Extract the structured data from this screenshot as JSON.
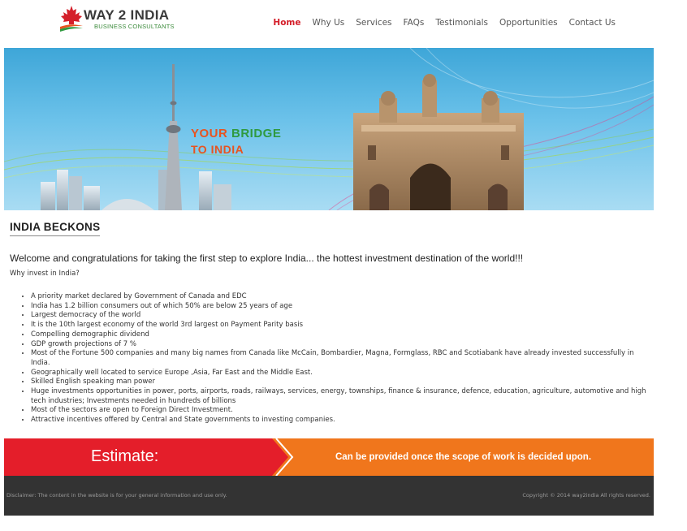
{
  "brand": {
    "name": "WAY 2 INDIA",
    "subtitle": "BUSINESS CONSULTANTS",
    "leaf_color": "#d41f2a"
  },
  "nav": {
    "items": [
      {
        "label": "Home",
        "active": true
      },
      {
        "label": "Why Us"
      },
      {
        "label": "Services"
      },
      {
        "label": "FAQs"
      },
      {
        "label": "Testimonials"
      },
      {
        "label": "Opportunities"
      },
      {
        "label": "Contact Us"
      }
    ],
    "active_color": "#d41f2a"
  },
  "banner": {
    "tagline_word1": "YOUR",
    "tagline_word2": "BRIDGE",
    "tagline_line2": "TO INDIA",
    "colors": {
      "orange": "#e8531f",
      "green": "#2f9a3f",
      "sky": "#4fb3e3"
    }
  },
  "content": {
    "heading": "INDIA BECKONS",
    "welcome": "Welcome and congratulations for taking the first step to explore India... the hottest investment destination of the world!!!",
    "why": "Why invest in India?",
    "reasons": [
      "A priority market declared by Government of Canada and EDC",
      "India has 1.2 billion consumers out of which 50% are below 25 years of age",
      "Largest democracy of the world",
      "It is the 10th largest economy of the world 3rd largest on Payment Parity basis",
      "Compelling demographic dividend",
      "GDP growth projections of 7 %",
      "Most of the Fortune 500 companies and many big names from Canada like McCain, Bombardier, Magna, Formglass, RBC and Scotiabank have already invested successfully in India.",
      "Geographically well located to service Europe ,Asia, Far East and the Middle East.",
      "Skilled English speaking man power",
      "Huge investments opportunities in power, ports, airports, roads, railways, services, energy, townships, finance & insurance, defence, education, agriculture, automotive and high tech industries; Investments needed in hundreds of billions",
      "Most of the sectors are open to Foreign Direct Investment.",
      "Attractive incentives offered by Central and State governments to investing companies."
    ]
  },
  "estimate": {
    "label": "Estimate:",
    "text": "Can be provided once the scope of work is decided upon.",
    "colors": {
      "red": "#e41e2a",
      "orange": "#f0761c"
    }
  },
  "footer": {
    "disclaimer": "Disclaimer: The content in the website is for your general information and use only.",
    "copyright": "Copyright © 2014 way2india All rights reserved."
  }
}
